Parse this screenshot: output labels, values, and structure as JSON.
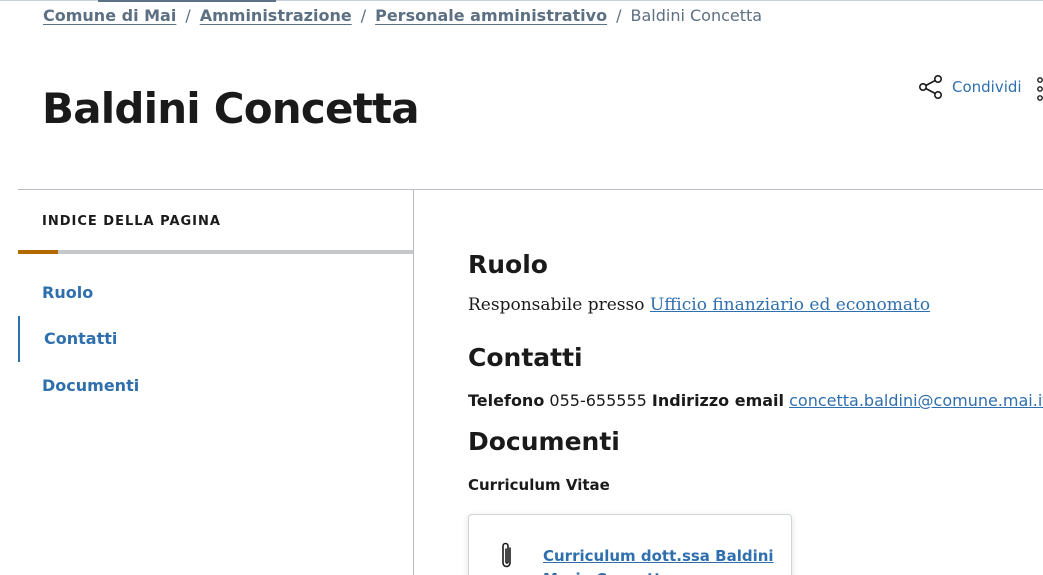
{
  "breadcrumb": {
    "items": [
      {
        "label": "Comune di Mai"
      },
      {
        "label": "Amministrazione"
      },
      {
        "label": "Personale amministrativo"
      }
    ],
    "separator": "/",
    "current": "Baldini Concetta"
  },
  "header": {
    "title": "Baldini Concetta",
    "share_label": "Condividi",
    "share_icon": "share-icon",
    "more_icon": "kebab-menu-icon"
  },
  "toc": {
    "title": "INDICE DELLA PAGINA",
    "progress": 0.1,
    "items": [
      {
        "label": "Ruolo",
        "active": false
      },
      {
        "label": "Contatti",
        "active": true
      },
      {
        "label": "Documenti",
        "active": false
      }
    ]
  },
  "content": {
    "role": {
      "heading": "Ruolo",
      "prefix": "Responsabile presso",
      "link": "Ufficio finanziario ed economato"
    },
    "contacts": {
      "heading": "Contatti",
      "phone_label": "Telefono",
      "phone_value": "055-655555",
      "email_label": "Indirizzo email",
      "email_value": "concetta.baldini@comune.mai.it"
    },
    "documents": {
      "heading": "Documenti",
      "subtitle": "Curriculum Vitae",
      "card": {
        "icon": "paperclip-icon",
        "link": "Curriculum dott.ssa Baldini Maria Concetta"
      }
    }
  },
  "colors": {
    "link": "#2f6fae",
    "accent": "#b26a00",
    "text": "#1a1a1a",
    "breadcrumb": "#5d7083"
  }
}
